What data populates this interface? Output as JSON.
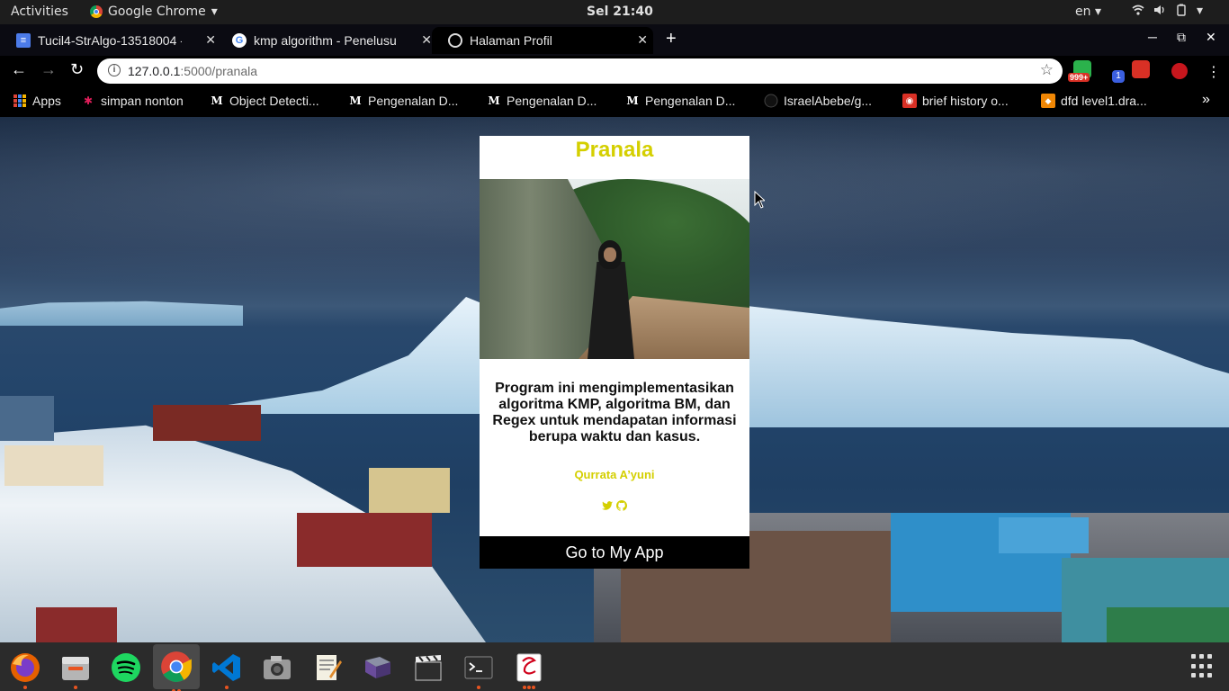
{
  "system": {
    "activities_label": "Activities",
    "app_menu_label": "Google Chrome",
    "clock": "Sel 21:40",
    "language": "en"
  },
  "browser": {
    "tabs": [
      {
        "title": "Tucil4-StrAlgo-13518004 -",
        "icon": "google-docs-icon"
      },
      {
        "title": "kmp algorithm - Penelusu",
        "icon": "google-icon"
      },
      {
        "title": "Halaman Profil",
        "icon": "globe-icon",
        "active": true
      }
    ],
    "address": {
      "host": "127.0.0.1",
      "path": ":5000/pranala"
    },
    "extension_badge": "999+",
    "extension_counter": "1",
    "bookmarks": [
      {
        "label": "Apps",
        "icon": "apps-grid-icon"
      },
      {
        "label": "simpan nonton",
        "icon": "slack-icon"
      },
      {
        "label": "Object Detecti...",
        "icon": "medium-icon"
      },
      {
        "label": "Pengenalan D...",
        "icon": "medium-icon"
      },
      {
        "label": "Pengenalan D...",
        "icon": "medium-icon"
      },
      {
        "label": "Pengenalan D...",
        "icon": "medium-icon"
      },
      {
        "label": "IsraelAbebe/g...",
        "icon": "github-icon"
      },
      {
        "label": "brief history o...",
        "icon": "red-bookmark-icon"
      },
      {
        "label": "dfd level1.dra...",
        "icon": "drawio-icon"
      }
    ]
  },
  "card": {
    "title": "Pranala",
    "description": "Program ini mengimplementasikan algoritma KMP, algoritma BM, dan Regex untuk mendapatan informasi berupa waktu dan kasus.",
    "author": "Qurrata A’yuni",
    "button_label": "Go to My App",
    "accent_color": "#d4cf00"
  },
  "dock": {
    "apps": [
      "firefox-icon",
      "files-icon",
      "spotify-icon",
      "chrome-icon",
      "vscode-icon",
      "camera-icon",
      "text-editor-icon",
      "book-icon",
      "video-editor-icon",
      "terminal-icon",
      "tracker-icon"
    ]
  }
}
